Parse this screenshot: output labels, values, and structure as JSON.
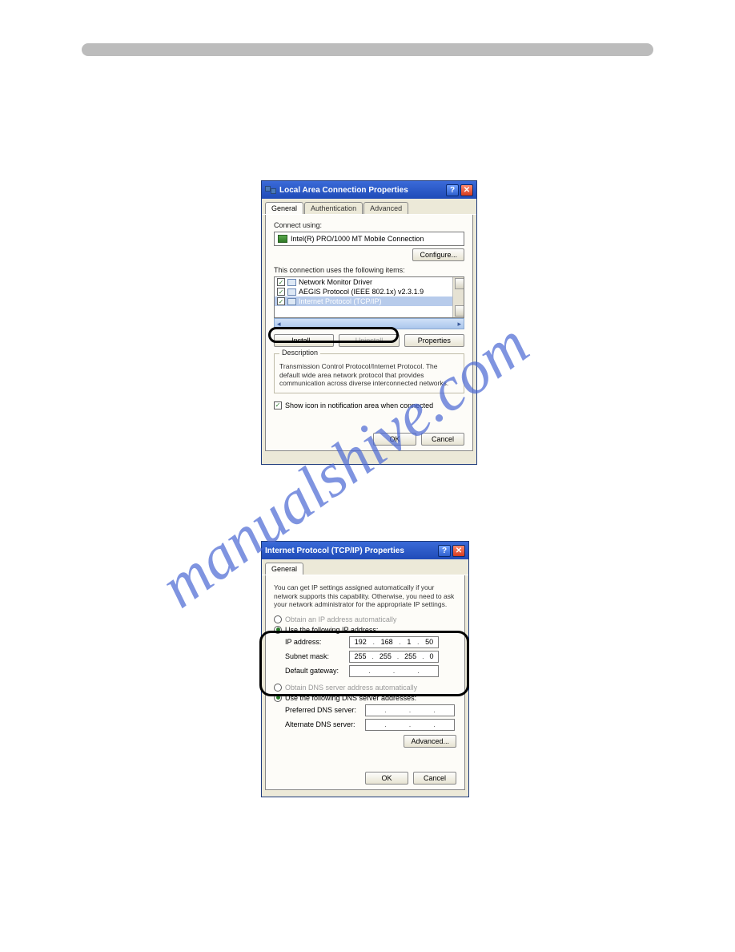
{
  "watermark": "manualshive.com",
  "dialog1": {
    "title": "Local Area Connection Properties",
    "tabs": [
      "General",
      "Authentication",
      "Advanced"
    ],
    "connect_using_lbl": "Connect using:",
    "adapter": "Intel(R) PRO/1000 MT Mobile Connection",
    "configure_btn": "Configure...",
    "items_lbl": "This connection uses the following items:",
    "items": [
      {
        "label": "Network Monitor Driver",
        "checked": true,
        "selected": false
      },
      {
        "label": "AEGIS Protocol (IEEE 802.1x) v2.3.1.9",
        "checked": true,
        "selected": false
      },
      {
        "label": "Internet Protocol (TCP/IP)",
        "checked": true,
        "selected": true
      }
    ],
    "install_btn": "Install...",
    "uninstall_btn": "Uninstall",
    "properties_btn": "Properties",
    "desc_title": "Description",
    "desc_text": "Transmission Control Protocol/Internet Protocol. The default wide area network protocol that provides communication across diverse interconnected networks.",
    "show_icon_lbl": "Show icon in notification area when connected",
    "ok": "OK",
    "cancel": "Cancel"
  },
  "dialog2": {
    "title": "Internet Protocol (TCP/IP) Properties",
    "tab": "General",
    "intro": "You can get IP settings assigned automatically if your network supports this capability. Otherwise, you need to ask your network administrator for the appropriate IP settings.",
    "obtain_ip": "Obtain an IP address automatically",
    "use_ip": "Use the following IP address:",
    "ip_lbl": "IP address:",
    "ip_val": [
      "192",
      "168",
      "1",
      "50"
    ],
    "mask_lbl": "Subnet mask:",
    "mask_val": [
      "255",
      "255",
      "255",
      "0"
    ],
    "gw_lbl": "Default gateway:",
    "gw_val": [
      "",
      "",
      "",
      ""
    ],
    "obtain_dns": "Obtain DNS server address automatically",
    "use_dns": "Use the following DNS server addresses:",
    "pref_dns_lbl": "Preferred DNS server:",
    "pref_dns_val": [
      "",
      "",
      "",
      ""
    ],
    "alt_dns_lbl": "Alternate DNS server:",
    "alt_dns_val": [
      "",
      "",
      "",
      ""
    ],
    "advanced_btn": "Advanced...",
    "ok": "OK",
    "cancel": "Cancel"
  }
}
